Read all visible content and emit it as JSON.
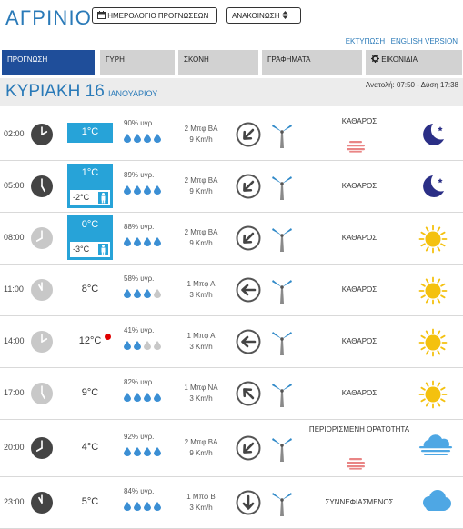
{
  "header": {
    "city": "ΑΓΡΙΝΙΟ",
    "calendar_button": "ΗΜΕΡΟΛΟΓΙΟ ΠΡΟΓΝΩΣΕΩΝ",
    "announcements_button": "ΑΝΑΚΟΙΝΩΣΗ",
    "print_link": "ΕΚΤΥΠΩΣΗ",
    "separator": "|",
    "english_link": "ENGLISH VERSION"
  },
  "tabs": [
    {
      "label": "ΠΡΟΓΝΩΣΗ",
      "active": true
    },
    {
      "label": "ΓΥΡΗ",
      "active": false
    },
    {
      "label": "ΣΚΟΝΗ",
      "active": false
    },
    {
      "label": "ΓΡΑΦΗΜΑΤΑ",
      "active": false
    },
    {
      "label": "ΕΙΚΟΝΙΔΙΑ",
      "active": false
    }
  ],
  "day": {
    "name": "ΚΥΡΙΑΚΗ 16",
    "month": "ΙΑΝΟΥΑΡΙΟΥ",
    "sun_times": "Ανατολή: 07:50 - Δύση 17:38"
  },
  "colors": {
    "accent": "#2a7ab8",
    "tab_active": "#1f4e9a",
    "temp_box": "#27a3d8",
    "sun": "#f4c10f",
    "moon": "#2b2f86",
    "cloud": "#4ea7e4",
    "haze": "#e98585"
  },
  "rows": [
    {
      "time": "02:00",
      "temp": "1°C",
      "feels": "",
      "boxed": true,
      "night": true,
      "humidity": "90% υγρ.",
      "drops": [
        1,
        1,
        1,
        1
      ],
      "wind_speed": "2 Μπφ ΒΑ",
      "wind_kmh": "9 Km/h",
      "arrow_deg": 45,
      "condition": "ΚΑΘΑΡΟΣ",
      "haze": true,
      "icon": "moon-icon",
      "red_dot": false
    },
    {
      "time": "05:00",
      "temp": "1°C",
      "feels": "-2°C",
      "boxed": true,
      "night": true,
      "humidity": "89% υγρ.",
      "drops": [
        1,
        1,
        1,
        1
      ],
      "wind_speed": "2 Μπφ ΒΑ",
      "wind_kmh": "9 Km/h",
      "arrow_deg": 45,
      "condition": "ΚΑΘΑΡΟΣ",
      "haze": false,
      "icon": "moon-icon",
      "red_dot": false
    },
    {
      "time": "08:00",
      "temp": "0°C",
      "feels": "-3°C",
      "boxed": true,
      "night": false,
      "humidity": "88% υγρ.",
      "drops": [
        1,
        1,
        1,
        1
      ],
      "wind_speed": "2 Μπφ ΒΑ",
      "wind_kmh": "9 Km/h",
      "arrow_deg": 45,
      "condition": "ΚΑΘΑΡΟΣ",
      "haze": false,
      "icon": "sun-icon",
      "red_dot": false
    },
    {
      "time": "11:00",
      "temp": "8°C",
      "feels": "",
      "boxed": false,
      "night": false,
      "humidity": "58% υγρ.",
      "drops": [
        1,
        1,
        1,
        0
      ],
      "wind_speed": "1 Μπφ Α",
      "wind_kmh": "3 Km/h",
      "arrow_deg": 90,
      "condition": "ΚΑΘΑΡΟΣ",
      "haze": false,
      "icon": "sun-icon",
      "red_dot": false
    },
    {
      "time": "14:00",
      "temp": "12°C",
      "feels": "",
      "boxed": false,
      "night": false,
      "humidity": "41% υγρ.",
      "drops": [
        1,
        1,
        0,
        0
      ],
      "wind_speed": "1 Μπφ Α",
      "wind_kmh": "3 Km/h",
      "arrow_deg": 90,
      "condition": "ΚΑΘΑΡΟΣ",
      "haze": false,
      "icon": "sun-icon",
      "red_dot": true
    },
    {
      "time": "17:00",
      "temp": "9°C",
      "feels": "",
      "boxed": false,
      "night": false,
      "humidity": "82% υγρ.",
      "drops": [
        1,
        1,
        1,
        1
      ],
      "wind_speed": "1 Μπφ ΝΑ",
      "wind_kmh": "3 Km/h",
      "arrow_deg": 135,
      "condition": "ΚΑΘΑΡΟΣ",
      "haze": false,
      "icon": "sun-icon",
      "red_dot": false
    },
    {
      "time": "20:00",
      "temp": "4°C",
      "feels": "",
      "boxed": false,
      "night": true,
      "humidity": "92% υγρ.",
      "drops": [
        1,
        1,
        1,
        1
      ],
      "wind_speed": "2 Μπφ ΒΑ",
      "wind_kmh": "9 Km/h",
      "arrow_deg": 45,
      "condition": "ΠΕΡΙΟΡΙΣΜΕΝΗ ΟΡΑΤΟΤΗΤΑ",
      "haze": true,
      "icon": "fog-icon",
      "red_dot": false
    },
    {
      "time": "23:00",
      "temp": "5°C",
      "feels": "",
      "boxed": false,
      "night": true,
      "humidity": "84% υγρ.",
      "drops": [
        1,
        1,
        1,
        1
      ],
      "wind_speed": "1 Μπφ Β",
      "wind_kmh": "3 Km/h",
      "arrow_deg": 0,
      "condition": "ΣΥΝΝΕΦΙΑΣΜΕΝΟΣ",
      "haze": false,
      "icon": "cloud-icon",
      "red_dot": false
    }
  ]
}
